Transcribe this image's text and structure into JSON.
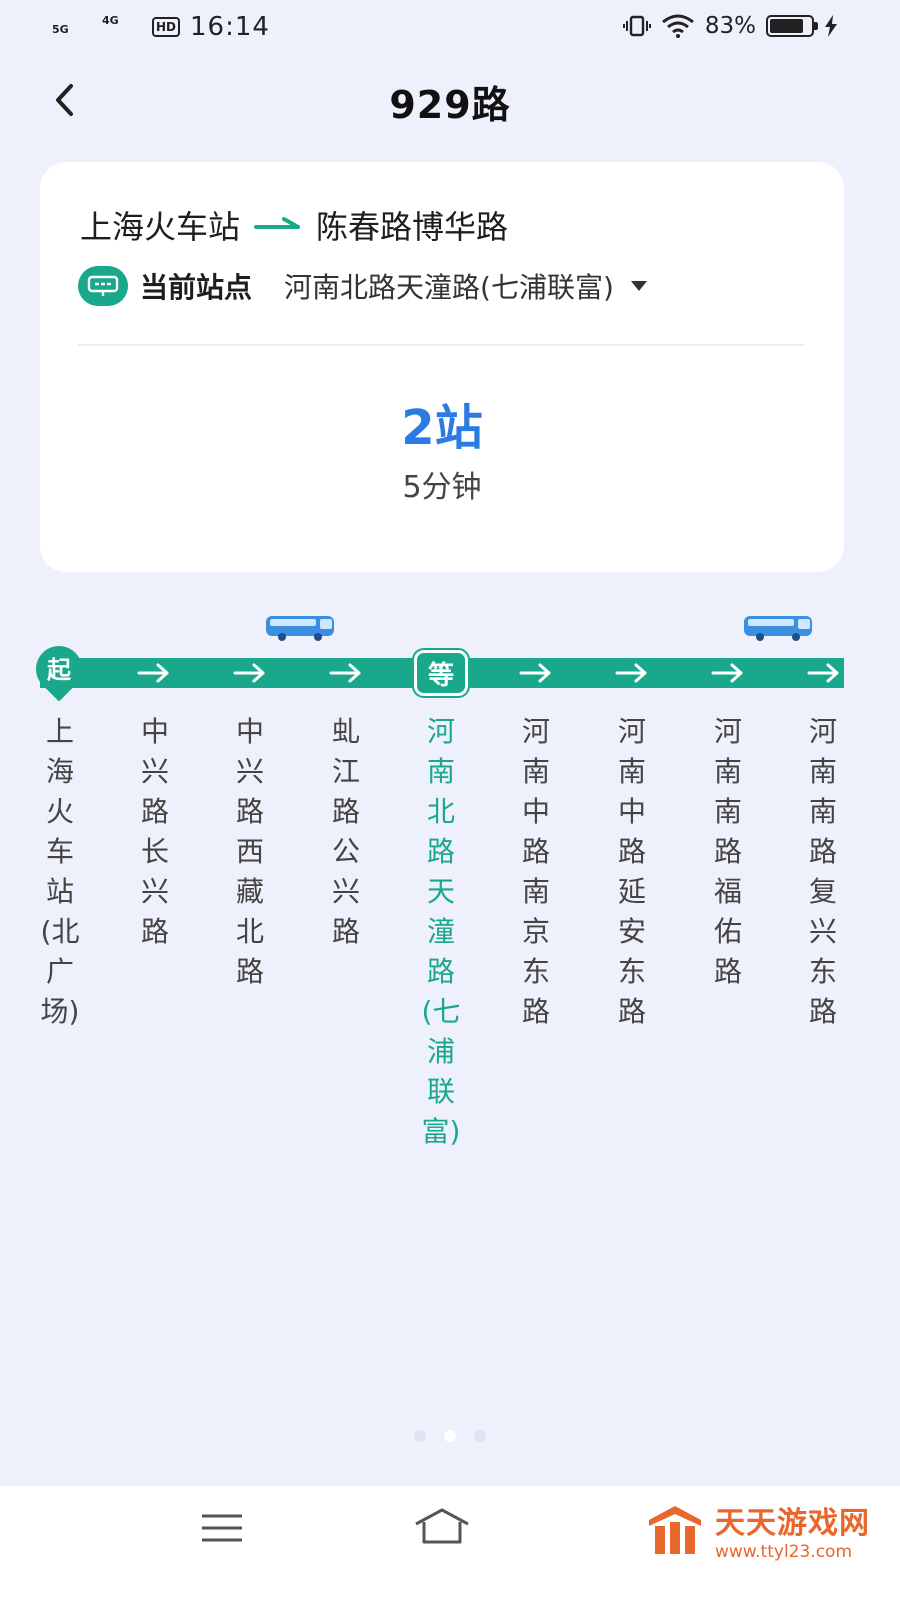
{
  "status_bar": {
    "net1": "5G",
    "net2": "4G",
    "hd": "HD",
    "time": "16:14",
    "battery": "83%",
    "battery_level": 0.83
  },
  "header": {
    "title": "929路"
  },
  "card": {
    "from": "上海火车站",
    "to": "陈春路博华路",
    "current_label": "当前站点",
    "current_value": "河南北路天潼路(七浦联富)",
    "stops": "2站",
    "eta": "5分钟"
  },
  "route": {
    "start_marker": "起",
    "wait_marker": "等",
    "stations": [
      "上海火车站(北广场)",
      "中兴路长兴路",
      "中兴路西藏北路",
      "虬江路公兴路",
      "河南北路天潼路(七浦联富)",
      "河南中路南京东路",
      "河南中路延安东路",
      "河南南路福佑路",
      "河南南路复兴东路"
    ],
    "active_index": 4
  },
  "colors": {
    "accent": "#1aa88c",
    "stops_blue": "#2c7be5",
    "bg": "#eef0fb"
  },
  "icons": [
    "back-icon",
    "route-arrow-icon",
    "bus-stop-icon",
    "dropdown-icon",
    "bus-icon",
    "menu-icon",
    "home-icon"
  ],
  "watermark": {
    "title": "天天游戏网",
    "url": "www.ttyl23.com"
  }
}
